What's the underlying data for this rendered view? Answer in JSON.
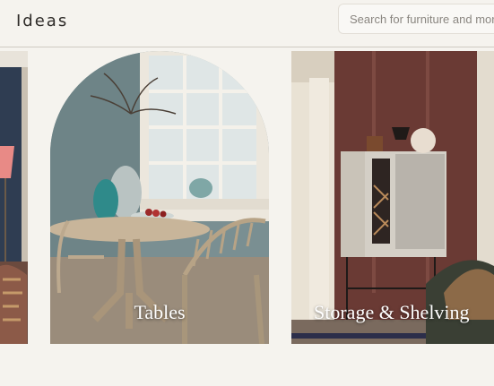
{
  "header": {
    "title": "Ideas",
    "search_placeholder": "Search for furniture and more"
  },
  "cards": [
    {
      "label": ""
    },
    {
      "label": "Tables"
    },
    {
      "label": "Storage & Shelving"
    }
  ]
}
